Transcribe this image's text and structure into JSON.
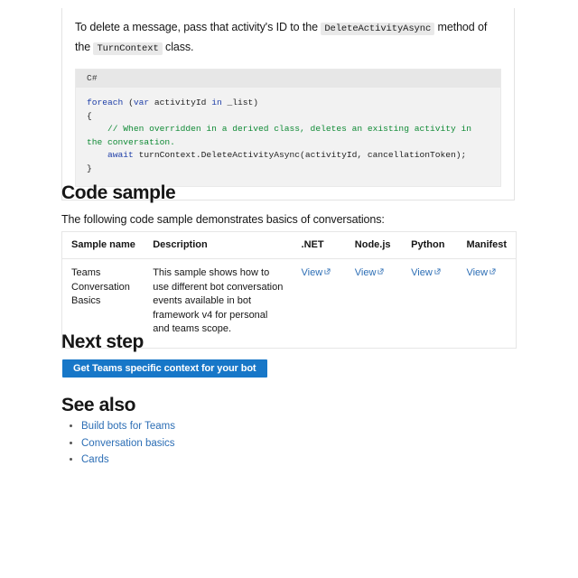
{
  "intro": {
    "text_part1": "To delete a message, pass that activity's ID to the ",
    "code1": "DeleteActivityAsync",
    "text_part2": " method of the ",
    "code2": "TurnContext",
    "text_part3": " class."
  },
  "codeblock": {
    "language_label": "C#",
    "lines": {
      "l1_kw": "foreach",
      "l1_a": " (",
      "l1_kw2": "var",
      "l1_b": " activityId ",
      "l1_kw3": "in",
      "l1_c": " _list)",
      "l2": "{",
      "l3_comment": "    // When overridden in a derived class, deletes an existing activity in the conversation.",
      "l4_kw": "    await",
      "l4_rest": " turnContext.DeleteActivityAsync(activityId, cancellationToken);",
      "l5": "}"
    }
  },
  "sections": {
    "code_sample_heading": "Code sample",
    "code_sample_lede": "The following code sample demonstrates basics of conversations:",
    "next_step_heading": "Next step",
    "see_also_heading": "See also"
  },
  "table": {
    "headers": [
      "Sample name",
      "Description",
      ".NET",
      "Node.js",
      "Python",
      "Manifest"
    ],
    "rows": [
      {
        "sample_name": "Teams Conversation Basics",
        "description": "This sample shows how to use different bot conversation events available in bot framework v4 for personal and teams scope.",
        "dotnet": "View",
        "nodejs": "View",
        "python": "View",
        "manifest": "View"
      }
    ]
  },
  "next_step": {
    "button_label": "Get Teams specific context for your bot",
    "button_color": "#1777c8"
  },
  "see_also": {
    "links": [
      "Build bots for Teams",
      "Conversation basics",
      "Cards"
    ]
  },
  "colors": {
    "link": "#2c6eb5",
    "keyword": "#1f3fa8",
    "comment": "#0f8a35",
    "code_bg": "#f2f2f2",
    "code_head_bg": "#e7e7e7",
    "inline_code_bg": "#e9e9e9",
    "border": "#e3e3e3"
  }
}
